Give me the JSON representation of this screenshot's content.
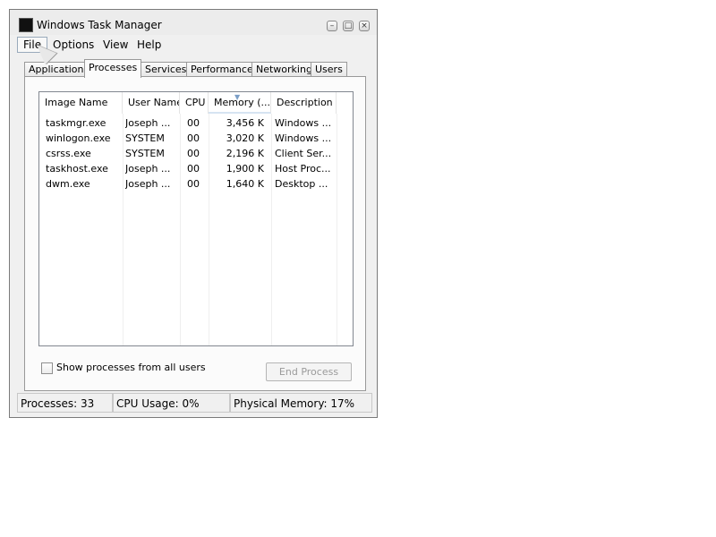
{
  "window": {
    "title": "Windows Task Manager",
    "controls": [
      "minimize-icon",
      "maximize-icon",
      "close-icon"
    ]
  },
  "menu": {
    "items": [
      {
        "label": "File",
        "active": true
      },
      {
        "label": "Options"
      },
      {
        "label": "View"
      },
      {
        "label": "Help"
      }
    ]
  },
  "tabs": [
    {
      "label": "Applications"
    },
    {
      "label": "Processes",
      "selected": true
    },
    {
      "label": "Services"
    },
    {
      "label": "Performance"
    },
    {
      "label": "Networking"
    },
    {
      "label": "Users"
    }
  ],
  "table": {
    "columns": [
      "Image Name",
      "User Name",
      "CPU",
      "Memory (...",
      "Description"
    ],
    "sorted_column": "Memory (...",
    "rows": [
      [
        "taskmgr.exe",
        "Joseph ...",
        "00",
        "3,456 K",
        "Windows ..."
      ],
      [
        "winlogon.exe",
        "SYSTEM",
        "00",
        "3,020 K",
        "Windows ..."
      ],
      [
        "csrss.exe",
        "SYSTEM",
        "00",
        "2,196 K",
        "Client Ser..."
      ],
      [
        "taskhost.exe",
        "Joseph ...",
        "00",
        "1,900 K",
        "Host Proc..."
      ],
      [
        "dwm.exe",
        "Joseph ...",
        "00",
        "1,640 K",
        "Desktop ..."
      ]
    ]
  },
  "show_all_users": {
    "label": "Show processes from all users",
    "checked": false
  },
  "end_process": {
    "label": "End Process",
    "enabled": false
  },
  "status": {
    "processes": "Processes: 33",
    "cpu": "CPU Usage: 0%",
    "memory": "Physical Memory: 17%"
  },
  "colors": {
    "accent": "#7b9ec6",
    "window_bg": "#f0f0f0",
    "disabled_text": "#9a9a9a"
  }
}
